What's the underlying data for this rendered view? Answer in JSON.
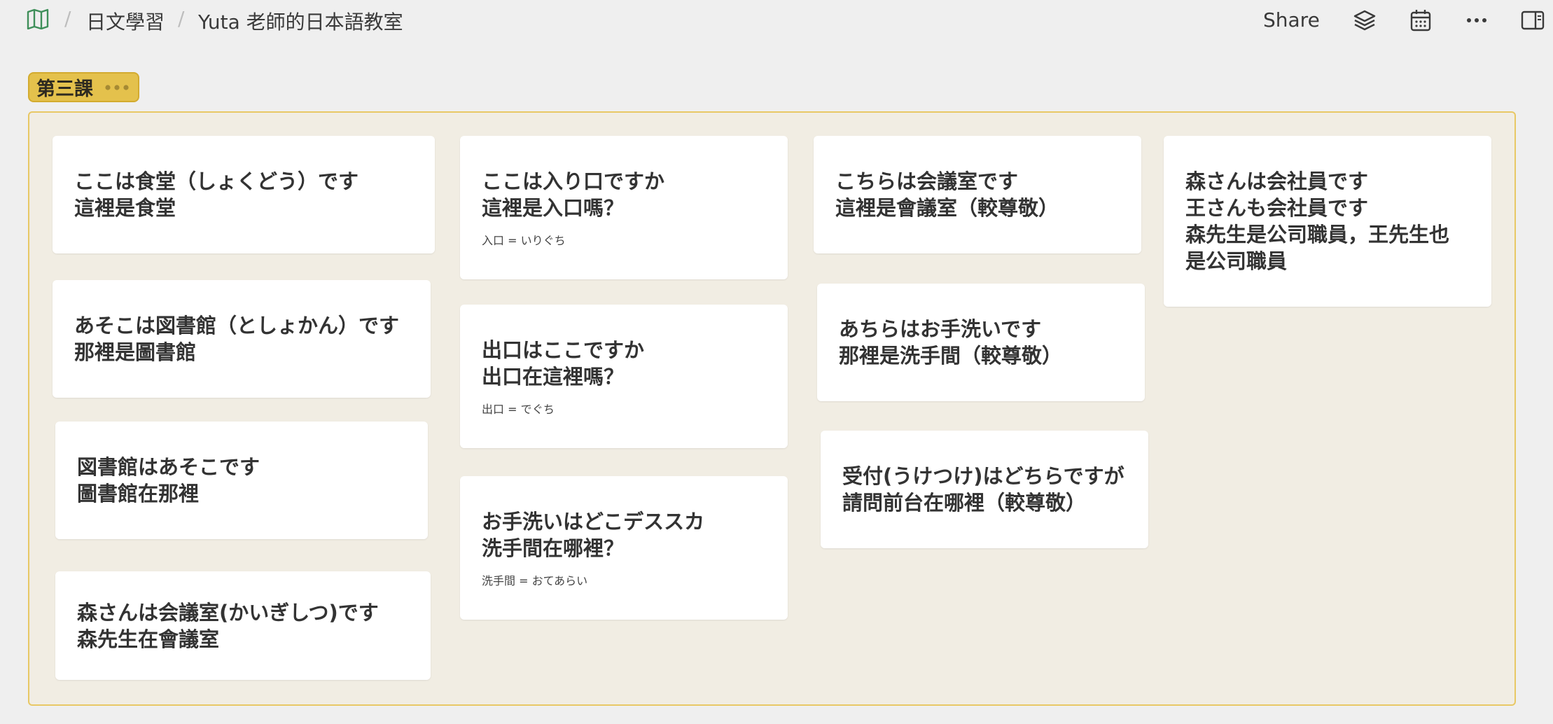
{
  "breadcrumb": {
    "items": [
      "日文學習",
      "Yuta 老師的日本語教室"
    ],
    "separator": "/",
    "icon": "book-open-icon"
  },
  "toolbar": {
    "share_label": "Share",
    "icons": [
      "layers-icon",
      "calendar-icon",
      "more-icon",
      "sidebar-toggle-icon"
    ]
  },
  "group": {
    "label": "第三課",
    "menu_icon": "more-dots-icon"
  },
  "colors": {
    "accent": "#e4c14c",
    "board_bg": "#f1ede3",
    "board_border": "#e8c865",
    "app_bg": "#efefef",
    "icon_green": "#3f8f5a"
  },
  "cards": [
    {
      "lines": [
        "ここは食堂（しょくどう）です",
        "這裡是食堂"
      ]
    },
    {
      "lines": [
        "あそこは図書館（としょかん）です",
        "那裡是圖書館"
      ]
    },
    {
      "lines": [
        "図書館はあそこです",
        "圖書館在那裡"
      ]
    },
    {
      "lines": [
        "森さんは会議室(かいぎしつ)です",
        "森先生在會議室"
      ]
    },
    {
      "lines": [
        "ここは入り口ですか",
        "這裡是入口嗎？"
      ],
      "note": "入口 = いりぐち"
    },
    {
      "lines": [
        "出口はここですか",
        "出口在這裡嗎？"
      ],
      "note": "出口 = でぐち"
    },
    {
      "lines": [
        "お手洗いはどこデススカ",
        "洗手間在哪裡？"
      ],
      "note": "洗手間 = おてあらい"
    },
    {
      "lines": [
        "こちらは会議室です",
        "這裡是會議室（較尊敬）"
      ]
    },
    {
      "lines": [
        "あちらはお手洗いです",
        "那裡是洗手間（較尊敬）"
      ]
    },
    {
      "lines": [
        "受付(うけつけ)はどちらですが",
        "請問前台在哪裡（較尊敬）"
      ]
    },
    {
      "lines": [
        "森さんは会社員です",
        "王さんも会社員です",
        "森先生是公司職員，王先生也",
        "是公司職員"
      ]
    }
  ]
}
